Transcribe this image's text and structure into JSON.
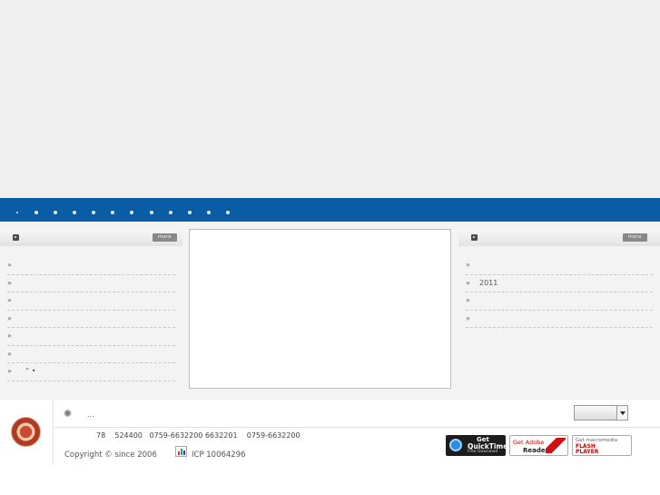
{
  "nav": {
    "items": [
      "",
      "",
      "",
      "",
      "",
      "",
      "",
      "",
      "",
      "",
      "",
      ""
    ]
  },
  "left_panel": {
    "more_label": "more",
    "items": [
      {
        "arrow": "»",
        "text": ""
      },
      {
        "arrow": "»",
        "text": ""
      },
      {
        "arrow": "»",
        "text": ""
      },
      {
        "arrow": "»",
        "text": ""
      },
      {
        "arrow": "»",
        "text": ""
      },
      {
        "arrow": "»",
        "text": ""
      },
      {
        "arrow": "»",
        "text": "“ •"
      }
    ]
  },
  "right_panel": {
    "more_label": "more",
    "items": [
      {
        "arrow": "»",
        "text": ""
      },
      {
        "arrow": "»",
        "text": "2011"
      },
      {
        "arrow": "»",
        "text": ""
      },
      {
        "arrow": "»",
        "text": ""
      }
    ]
  },
  "footer": {
    "ellipsis": "...",
    "contact": "78    524400   0759-6632200 6632201    0759-6632200",
    "copyright": "Copyright © since 2006",
    "icp": "ICP 10064296",
    "select_value": ""
  },
  "badges": {
    "quicktime": {
      "line1": "Get",
      "line2": "QuickTime",
      "line3": "Free Download"
    },
    "adobe": {
      "line1": "Get Adobe",
      "line2": "Reader"
    },
    "flash": {
      "line1": "Get macromedia",
      "line2": "FLASH",
      "line3": "PLAYER"
    }
  },
  "colors": {
    "nav_bg": "#0a5da5",
    "banner_bg": "#efefef"
  }
}
